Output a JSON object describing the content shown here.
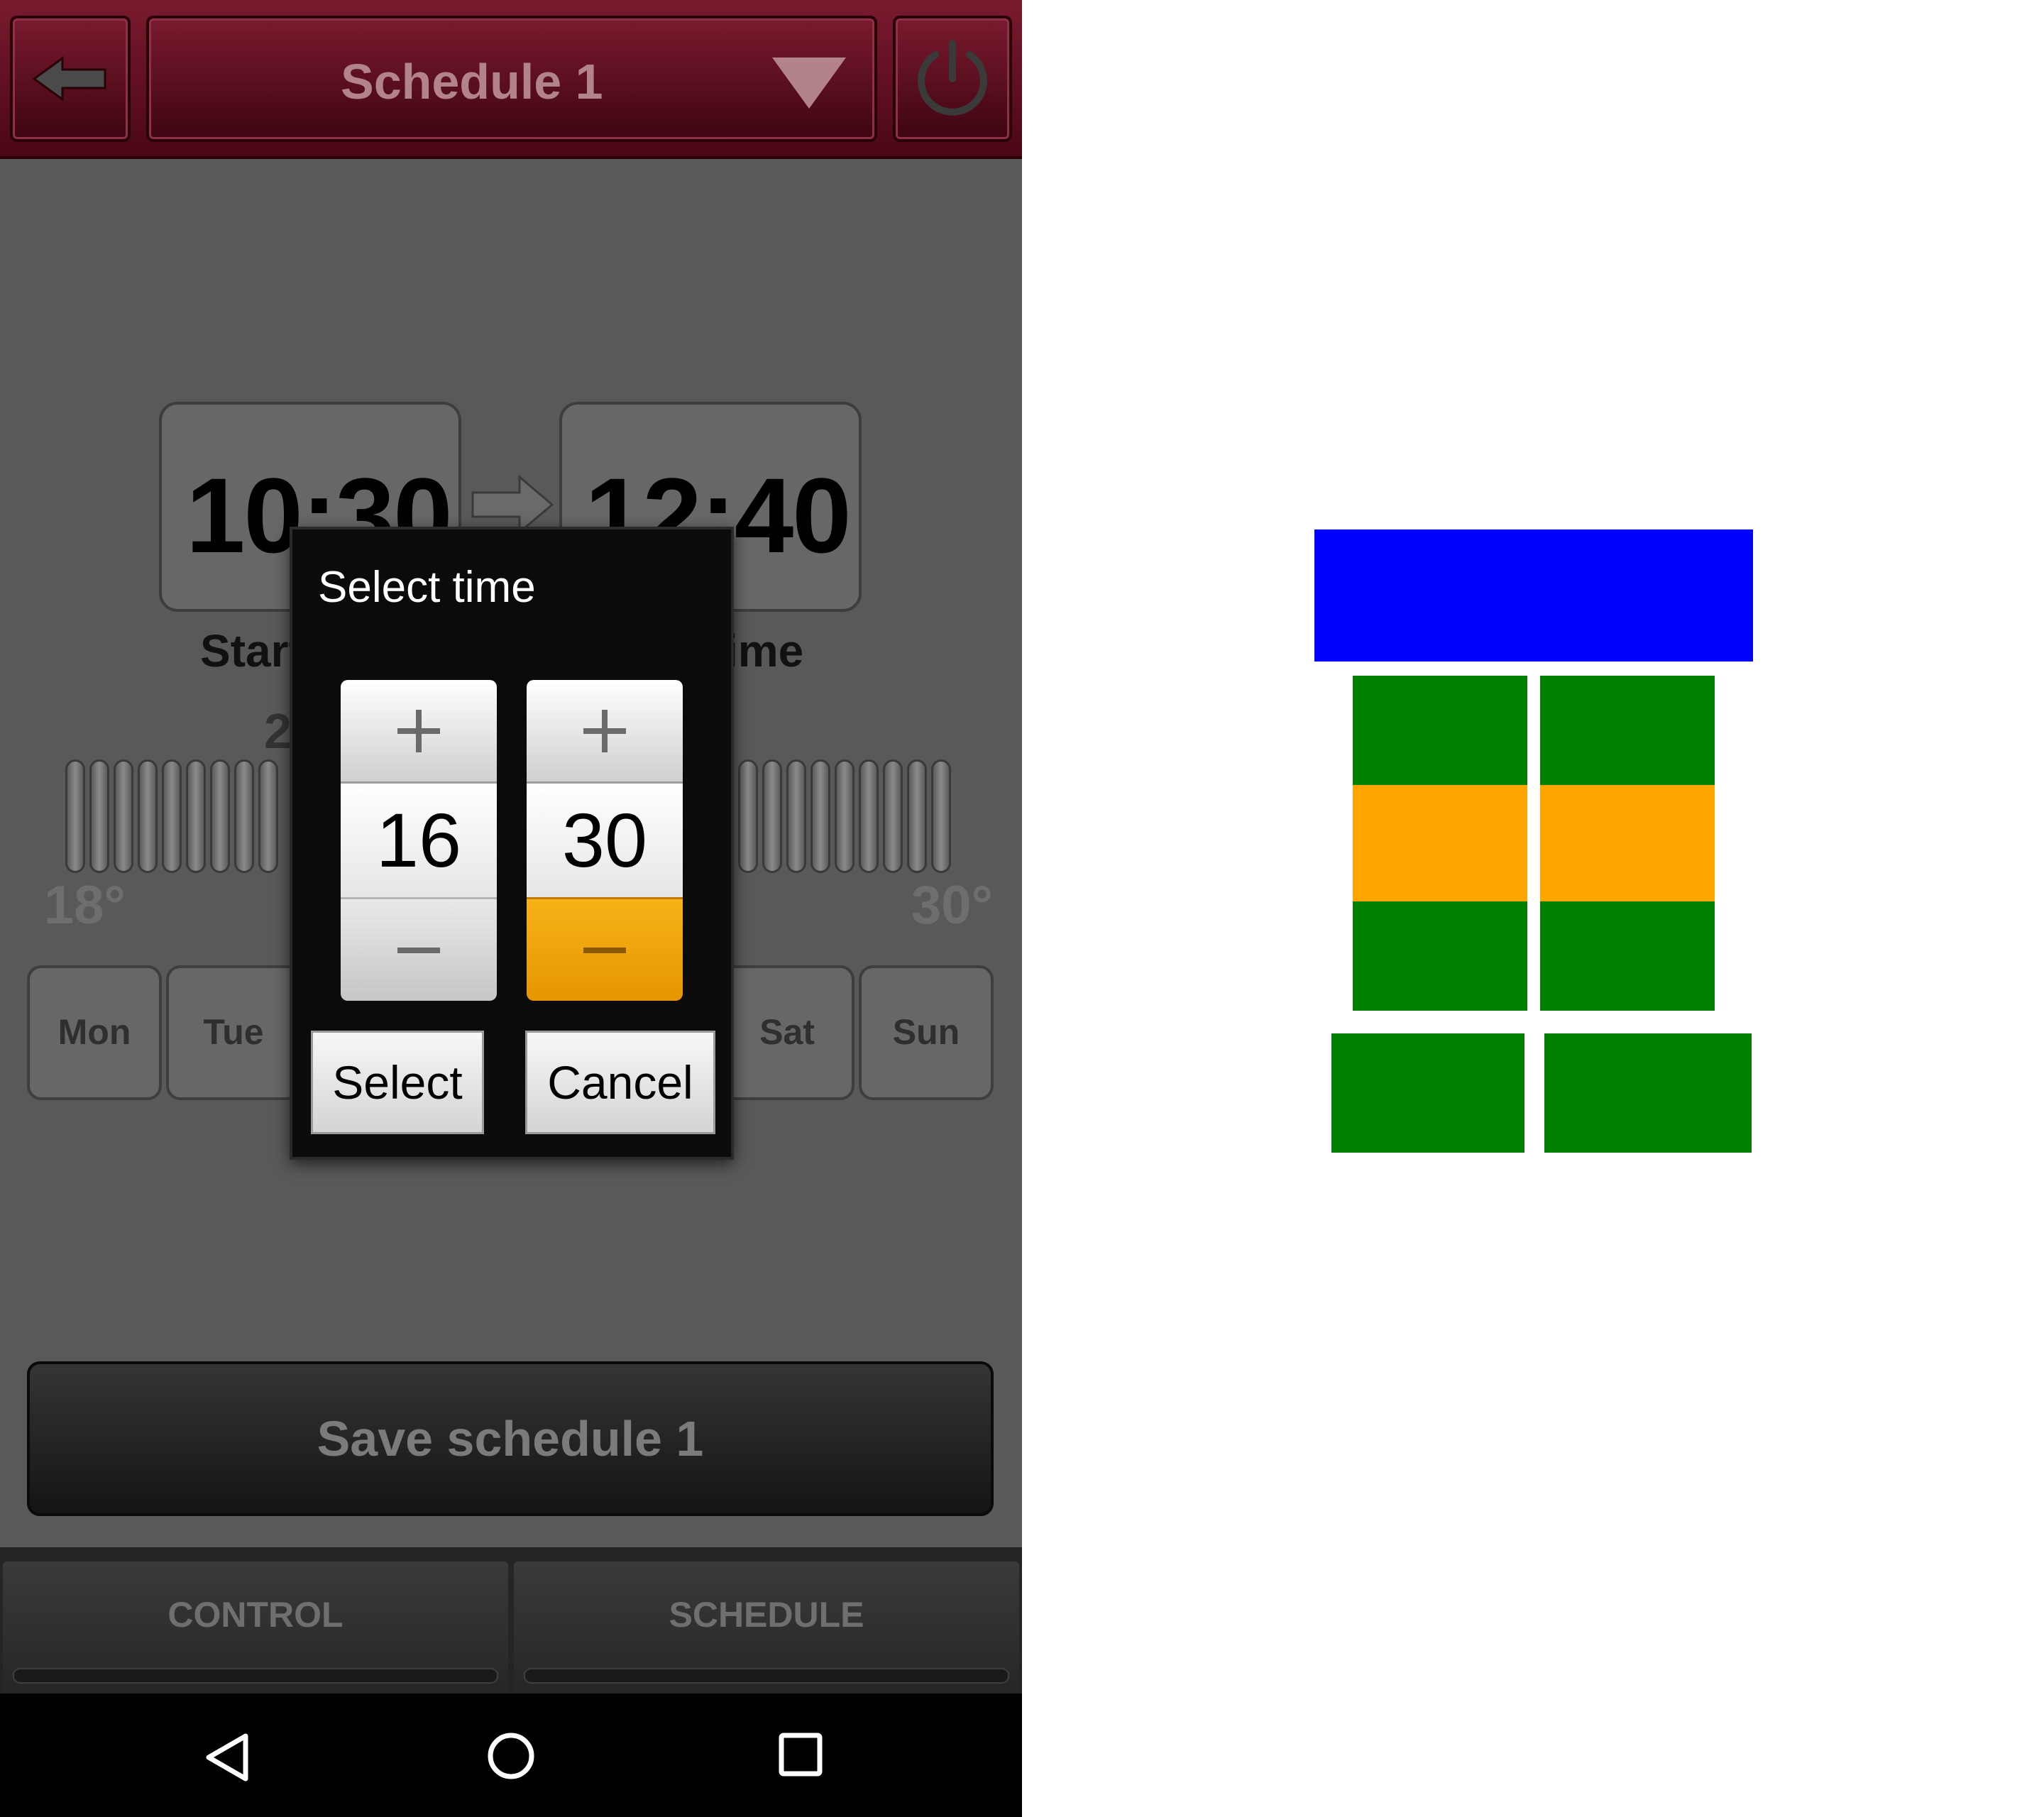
{
  "header": {
    "title": "Schedule 1",
    "colors": {
      "bar": "#5c0a1c",
      "text": "#b3838c"
    }
  },
  "schedule": {
    "start_time": "10:30",
    "end_time": "12:40",
    "start_label": "Start time",
    "end_label": "End time",
    "current_temp": "21",
    "temp_min": "18°",
    "temp_max": "30°",
    "days": [
      "Mon",
      "Tue",
      "Sat",
      "Sun"
    ],
    "save_label": "Save schedule 1"
  },
  "dialog": {
    "title": "Select time",
    "hour": "16",
    "minute": "30",
    "select_label": "Select",
    "cancel_label": "Cancel",
    "accent": "#f0a00a"
  },
  "tabs": [
    "CONTROL",
    "SCHEDULE"
  ],
  "nav": {
    "icons": [
      "nav-back-icon",
      "nav-home-icon",
      "nav-recent-icon"
    ]
  },
  "wireframe": {
    "colors": {
      "title": "#0000ff",
      "control": "#008000",
      "value": "#ffa500"
    }
  }
}
